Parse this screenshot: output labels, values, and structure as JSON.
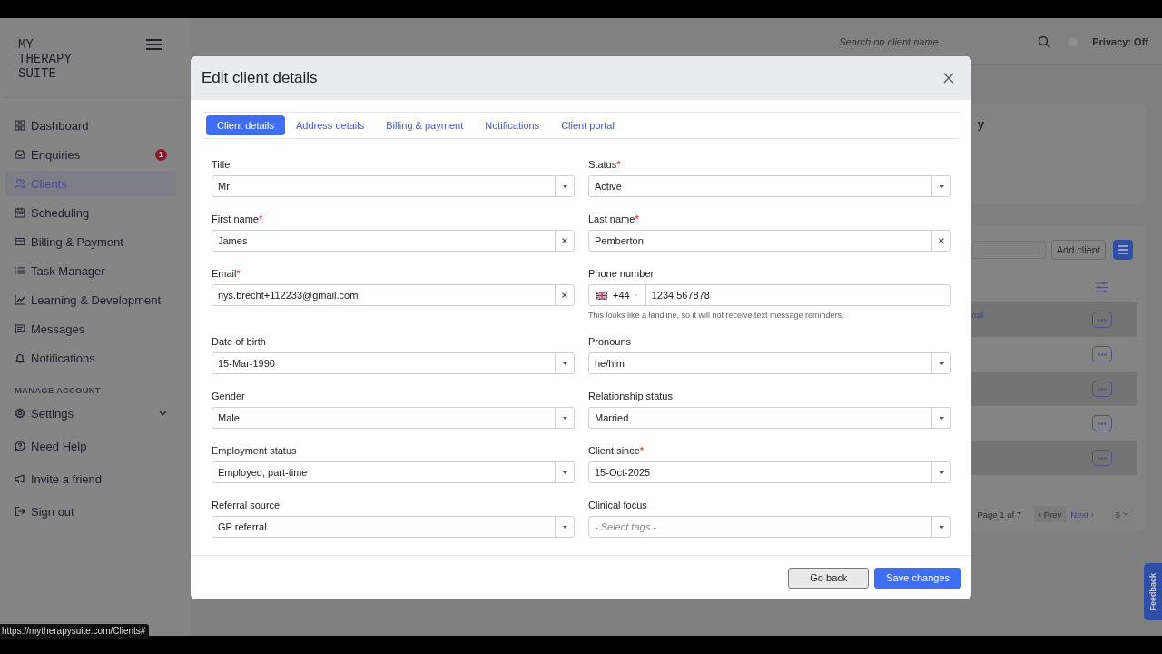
{
  "sidebar": {
    "logo": "MY THERAPY SUITE",
    "nav": [
      {
        "label": "Dashboard",
        "selected": false
      },
      {
        "label": "Enquiries",
        "selected": false,
        "badge": "1"
      },
      {
        "label": "Clients",
        "selected": true
      },
      {
        "label": "Scheduling",
        "selected": false
      },
      {
        "label": "Billing & Payment",
        "selected": false
      },
      {
        "label": "Task Manager",
        "selected": false
      },
      {
        "label": "Learning & Development",
        "selected": false
      },
      {
        "label": "Messages",
        "selected": false
      },
      {
        "label": "Notifications",
        "selected": false
      }
    ],
    "section_title": "MANAGE ACCOUNT",
    "account": [
      {
        "label": "Settings",
        "expandable": true,
        "selected": false
      },
      {
        "label": "Need Help",
        "expandable": false,
        "selected": false
      },
      {
        "label": "Invite a friend",
        "expandable": false,
        "selected": false
      },
      {
        "label": "Sign out",
        "expandable": false,
        "selected": false
      }
    ]
  },
  "topbar": {
    "search_placeholder": "Search on client name",
    "privacy": "Privacy: Off"
  },
  "background": {
    "heading": "y",
    "add_button": "Add client",
    "rows": [
      {
        "shaded": true,
        "link": "rral"
      },
      {
        "shaded": false
      },
      {
        "shaded": true
      },
      {
        "shaded": false
      },
      {
        "shaded": true
      }
    ],
    "page_info": "Page 1 of 7",
    "prev": {
      "label": "‹ Prev",
      "disabled": true
    },
    "next": {
      "label": "Next ›",
      "disabled": false
    },
    "page_size": "5"
  },
  "modal": {
    "title": "Edit client details",
    "tabs": [
      {
        "label": "Client details",
        "selected": true
      },
      {
        "label": "Address details",
        "selected": false
      },
      {
        "label": "Billing & payment",
        "selected": false
      },
      {
        "label": "Notifications",
        "selected": false
      },
      {
        "label": "Client portal",
        "selected": false
      }
    ],
    "fields": [
      {
        "kind": "select",
        "label": "Title",
        "value": "Mr"
      },
      {
        "kind": "select",
        "label": "Status",
        "required_mark": "*",
        "value": "Active"
      },
      {
        "kind": "text",
        "label": "First name",
        "required_mark": "*",
        "value": "James"
      },
      {
        "kind": "text",
        "label": "Last name",
        "required_mark": "*",
        "value": "Pemberton"
      },
      {
        "kind": "text",
        "label": "Email",
        "required_mark": "*",
        "value": "nys.brecht+112233@gmail.com"
      },
      {
        "kind": "phone",
        "label": "Phone number",
        "country_code": "+44",
        "value": "1234 567878",
        "hint": "This looks like a landline, so it will not receive text message reminders."
      },
      {
        "kind": "select",
        "label": "Date of birth",
        "value": "15-Mar-1990"
      },
      {
        "kind": "select",
        "label": "Pronouns",
        "value": "he/him"
      },
      {
        "kind": "select",
        "label": "Gender",
        "value": "Male"
      },
      {
        "kind": "select",
        "label": "Relationship status",
        "value": "Married"
      },
      {
        "kind": "select",
        "label": "Employment status",
        "value": "Employed, part-time"
      },
      {
        "kind": "select",
        "label": "Client since",
        "required_mark": "*",
        "value": "15-Oct-2025"
      },
      {
        "kind": "select",
        "label": "Referral source",
        "value": "GP referral"
      },
      {
        "kind": "select",
        "label": "Clinical focus",
        "placeholder": "- Select tags -"
      }
    ],
    "buttons": [
      {
        "label": "Go back",
        "kind": "secondary"
      },
      {
        "label": "Save changes",
        "kind": "primary"
      }
    ]
  },
  "feedback": "Feedback",
  "status_url": "https://mytherapysuite.com/Clients#"
}
